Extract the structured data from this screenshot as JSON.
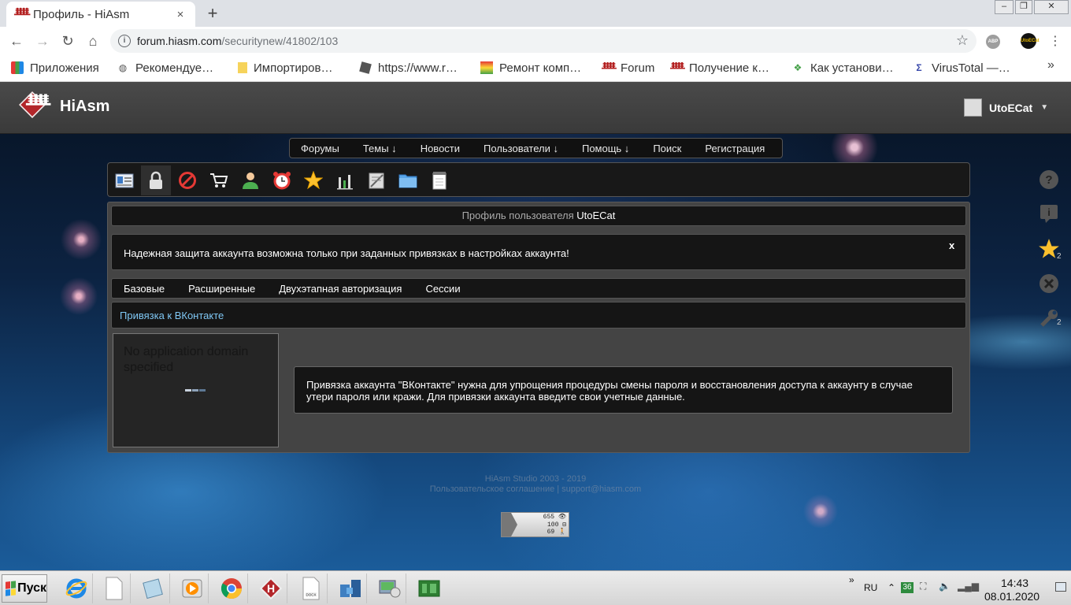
{
  "browser": {
    "tab_title": "Профиль - HiAsm",
    "tab_close": "×",
    "new_tab": "+",
    "window_controls": [
      "–",
      "❐",
      "✕"
    ],
    "url_host": "forum.hiasm.com",
    "url_path": "/securitynew/41802/103",
    "extension_abp": "ABP",
    "extension_avatar": "UtoECat",
    "bookmarks": [
      {
        "label": "Приложения",
        "icon": "apps-grid-icon"
      },
      {
        "label": "Рекомендуе…",
        "icon": "globe-icon"
      },
      {
        "label": "Импортиров…",
        "icon": "folder-icon"
      },
      {
        "label": "https://www.r…",
        "icon": "roblox-icon"
      },
      {
        "label": "Ремонт комп…",
        "icon": "monitor-icon"
      },
      {
        "label": "Forum",
        "icon": "hiasm-icon"
      },
      {
        "label": "Получение к…",
        "icon": "hiasm-icon"
      },
      {
        "label": "Как установи…",
        "icon": "diamond-icon"
      },
      {
        "label": "VirusTotal —…",
        "icon": "virustotal-icon"
      }
    ],
    "bookmarks_more": "»"
  },
  "site": {
    "title": "HiAsm",
    "username": "UtoECat",
    "nav": [
      "Форумы",
      "Темы ↓",
      "Новости",
      "Пользователи ↓",
      "Помощь ↓",
      "Поиск",
      "Регистрация"
    ],
    "icons": [
      "profile-card-icon",
      "lock-icon",
      "blocked-icon",
      "cart-icon",
      "user-icon",
      "alarm-clock-icon",
      "star-icon",
      "bar-chart-icon",
      "notes-icon",
      "folder-icon",
      "notepad-icon"
    ],
    "profile_title_prefix": "Профиль пользователя",
    "profile_title_user": "UtoECat",
    "notice": "Надежная защита аккаунта возможна только при заданных привязках в настройках аккаунта!",
    "notice_close": "x",
    "tabs": [
      "Базовые",
      "Расширенные",
      "Двухэтапная авторизация",
      "Сессии"
    ],
    "section_link": "Привязка к ВКонтакте",
    "widget_text": "No application domain specified",
    "info_text": "Привязка аккаунта \"ВКонтакте\" нужна для упрощения процедуры смены пароля и восстановления доступа к аккаунту в случае утери пароля или кражи. Для привязки аккаунта введите свои учетные данные.",
    "footer_line1": "HiAsm Studio 2003 - 2019",
    "footer_line2": "Пользовательское соглашение | support@hiasm.com",
    "counter": [
      "655 👁",
      "100 ⊟",
      "69 🚶"
    ],
    "side_badges": {
      "star": "2",
      "wrench": "2"
    }
  },
  "taskbar": {
    "start_label": "Пуск",
    "apps": [
      "ie-icon",
      "document-icon",
      "notepad-icon",
      "media-player-icon",
      "chrome-icon",
      "hiasm-icon",
      "docx-file-icon",
      "network-icon",
      "device-manager-icon",
      "green-board-icon"
    ],
    "tray_chevron": "»",
    "language": "RU",
    "tray_badge": "36",
    "time": "14:43",
    "date": "08.01.2020"
  },
  "colors": {
    "accent_link": "#7fc7f4",
    "header_bg": "#404040",
    "panel_bg": "#444444"
  }
}
